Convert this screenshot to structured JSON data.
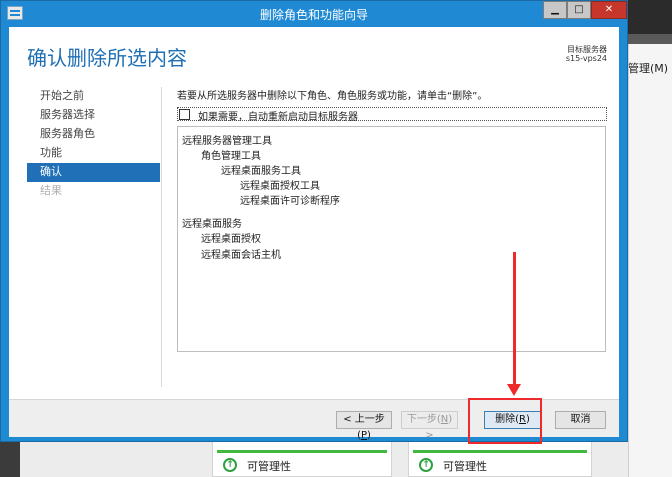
{
  "background": {
    "right_panel_label": "管理(M)",
    "cards": [
      {
        "status": "可管理性"
      },
      {
        "status": "可管理性"
      }
    ]
  },
  "window": {
    "title": "删除角色和功能向导",
    "controls": {
      "min": "▁",
      "max": "□",
      "close": "✕"
    }
  },
  "header": {
    "title": "确认删除所选内容",
    "target_label": "目标服务器",
    "target_name": "s15-vps24"
  },
  "nav": {
    "items": [
      {
        "label": "开始之前",
        "state": "normal"
      },
      {
        "label": "服务器选择",
        "state": "normal"
      },
      {
        "label": "服务器角色",
        "state": "normal"
      },
      {
        "label": "功能",
        "state": "normal"
      },
      {
        "label": "确认",
        "state": "active"
      },
      {
        "label": "结果",
        "state": "disabled"
      }
    ]
  },
  "main": {
    "intro": "若要从所选服务器中删除以下角色、角色服务或功能，请单击“删除”。",
    "restart_label": "如果需要，自动重新启动目标服务器",
    "restart_checked": false,
    "items": [
      {
        "label": "远程服务器管理工具",
        "level": 0
      },
      {
        "label": "角色管理工具",
        "level": 1
      },
      {
        "label": "远程桌面服务工具",
        "level": 2
      },
      {
        "label": "远程桌面授权工具",
        "level": 3
      },
      {
        "label": "远程桌面许可诊断程序",
        "level": 3
      },
      {
        "label": "远程桌面服务",
        "level": 0
      },
      {
        "label": "远程桌面授权",
        "level": 1
      },
      {
        "label": "远程桌面会话主机",
        "level": 1
      }
    ]
  },
  "footer": {
    "prev_prefix": "< 上一步(",
    "prev_key": "P",
    "prev_suffix": ")",
    "next_prefix": "下一步(",
    "next_key": "N",
    "next_suffix": ") >",
    "delete_prefix": "删除(",
    "delete_key": "R",
    "delete_suffix": ")",
    "cancel": "取消"
  },
  "colors": {
    "accent": "#1f70b7",
    "title_bar": "#1f8ad3",
    "annotation": "#ee2a2a",
    "status_ok": "#3fb93f"
  }
}
